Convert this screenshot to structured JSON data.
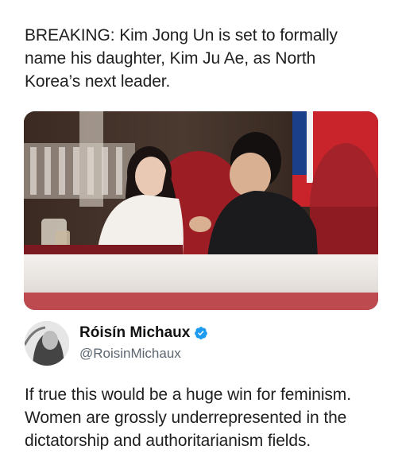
{
  "headline": "BREAKING: Kim Jong Un is set to formally name his daughter, Kim Ju Ae, as North Korea’s next leader.",
  "author": {
    "name": "Róisín Michaux",
    "handle": "@RoisinMichaux",
    "verified": true,
    "verified_color": "#1d9bf0"
  },
  "tweet_text": "If true this would be a huge win for feminism. Women are grossly underrepresented in the dictatorship and authoritarianism fields.",
  "icons": {
    "verified": "verified-badge-icon"
  }
}
